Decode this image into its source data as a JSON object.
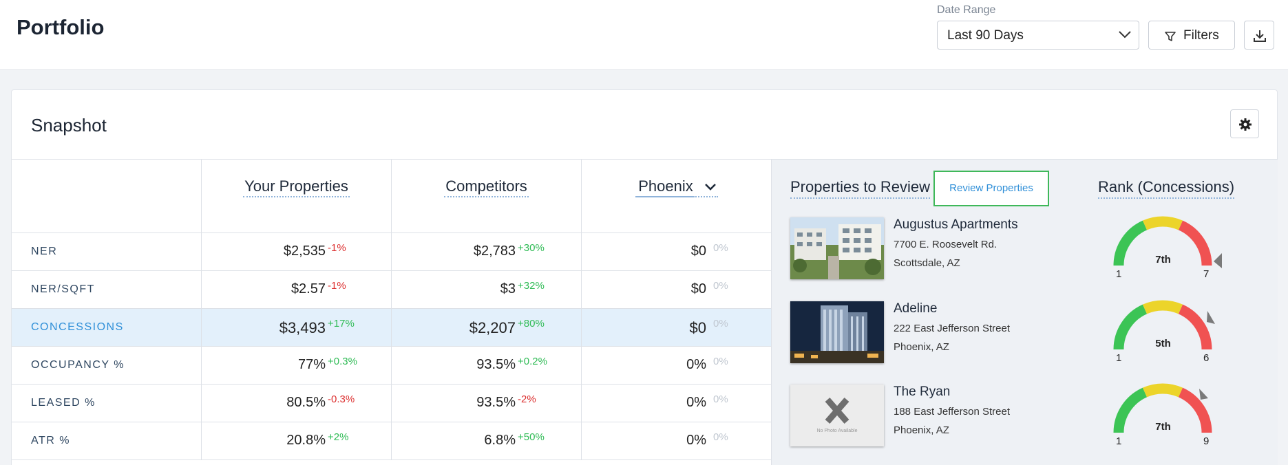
{
  "header": {
    "title": "Portfolio",
    "date_range_label": "Date Range",
    "date_range_value": "Last 90 Days",
    "filters_label": "Filters"
  },
  "snapshot": {
    "title": "Snapshot",
    "columns": [
      "Your Properties",
      "Competitors",
      "Phoenix"
    ],
    "rows": [
      {
        "label": "NER",
        "yours": "$2,535",
        "yours_chg": "-1%",
        "comp": "$2,783",
        "comp_chg": "+30%",
        "market": "$0",
        "market_chg": "0%"
      },
      {
        "label": "NER/SQFT",
        "yours": "$2.57",
        "yours_chg": "-1%",
        "comp": "$3",
        "comp_chg": "+32%",
        "market": "$0",
        "market_chg": "0%"
      },
      {
        "label": "CONCESSIONS",
        "yours": "$3,493",
        "yours_chg": "+17%",
        "comp": "$2,207",
        "comp_chg": "+80%",
        "market": "$0",
        "market_chg": "0%"
      },
      {
        "label": "OCCUPANCY %",
        "yours": "77%",
        "yours_chg": "+0.3%",
        "comp": "93.5%",
        "comp_chg": "+0.2%",
        "market": "0%",
        "market_chg": "0%"
      },
      {
        "label": "LEASED %",
        "yours": "80.5%",
        "yours_chg": "-0.3%",
        "comp": "93.5%",
        "comp_chg": "-2%",
        "market": "0%",
        "market_chg": "0%"
      },
      {
        "label": "ATR %",
        "yours": "20.8%",
        "yours_chg": "+2%",
        "comp": "6.8%",
        "comp_chg": "+50%",
        "market": "0%",
        "market_chg": "0%"
      }
    ]
  },
  "review": {
    "title": "Properties to Review",
    "button_label": "Review Properties",
    "rank_title": "Rank (Concessions)",
    "properties": [
      {
        "name": "Augustus Apartments",
        "address": "7700 E. Roosevelt Rd.",
        "city": "Scottsdale, AZ",
        "rank": "7th",
        "min": "1",
        "max": "7"
      },
      {
        "name": "Adeline",
        "address": "222 East Jefferson Street",
        "city": "Phoenix, AZ",
        "rank": "5th",
        "min": "1",
        "max": "6"
      },
      {
        "name": "The Ryan",
        "address": "188 East Jefferson Street",
        "city": "Phoenix, AZ",
        "rank": "7th",
        "min": "1",
        "max": "9"
      }
    ],
    "no_photo_text": "No Photo Available"
  },
  "colors": {
    "positive": "#2fbb55",
    "negative": "#dc3030",
    "accent": "#2f8fd8",
    "gauge_green": "#3cc455",
    "gauge_yellow": "#ecd42a",
    "gauge_red": "#f05252"
  }
}
